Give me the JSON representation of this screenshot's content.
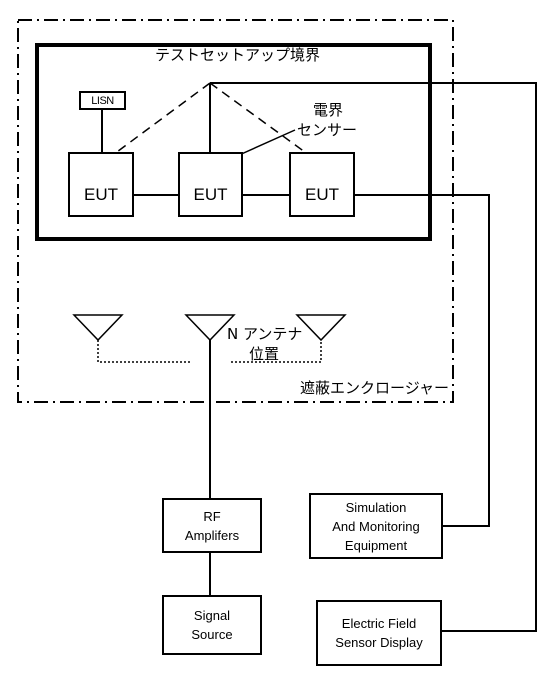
{
  "diagram": {
    "type": "radiated immunity test setup block diagram",
    "enclosure_label": "遮蔽エンクロージャー",
    "test_boundary_label": "テストセットアップ境界",
    "lisn_label": "LISN",
    "eut_boxes": [
      {
        "label": "EUT"
      },
      {
        "label": "EUT"
      },
      {
        "label": "EUT"
      }
    ],
    "field_sensor_label_line1": "電界",
    "field_sensor_label_line2": "センサー",
    "antenna_label_line1": "N アンテナ",
    "antenna_label_line2": "位置",
    "antenna_count_shown": 3,
    "equipment": {
      "rf_amplifiers": [
        "RF",
        "Amplifers"
      ],
      "signal_source": [
        "Signal",
        "Source"
      ],
      "simulation_monitoring": [
        "Simulation",
        "And Monitoring",
        "Equipment"
      ],
      "field_sensor_display": [
        "Electric Field",
        "Sensor Display"
      ]
    },
    "colors": {
      "line": "#000000",
      "background": "#ffffff"
    }
  }
}
